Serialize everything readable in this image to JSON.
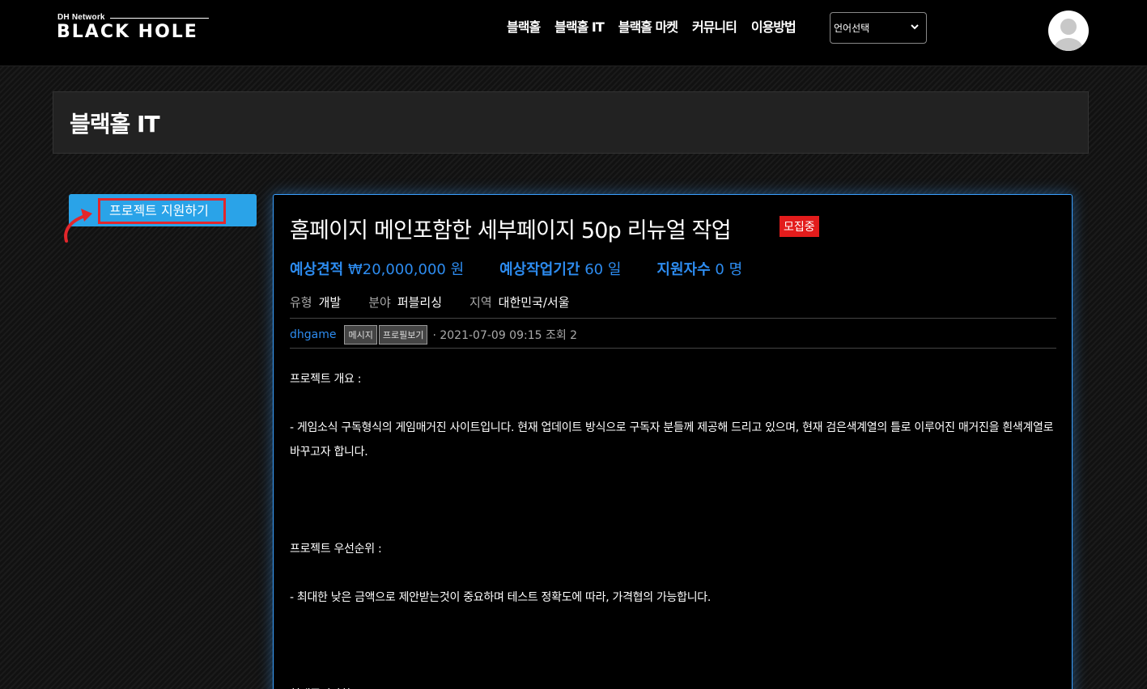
{
  "header": {
    "logo_small": "DH Network",
    "logo_main": "BLACK HOLE",
    "nav": [
      "블랙홀",
      "블랙홀 IT",
      "블랙홀 마켓",
      "커뮤니티",
      "이용방법"
    ],
    "lang_select": "언어선택"
  },
  "page": {
    "title": "블랙홀 IT"
  },
  "sidebar": {
    "apply_label": "프로젝트 지원하기"
  },
  "post": {
    "title": "홈페이지 메인포함한 세부페이지 50p 리뉴얼 작업",
    "status": "모집중",
    "stats": [
      {
        "label": "예상견적",
        "value": "₩20,000,000 원"
      },
      {
        "label": "예상작업기간",
        "value": "60 일"
      },
      {
        "label": "지원자수",
        "value": "0 명"
      }
    ],
    "meta": [
      {
        "key": "유형",
        "value": "개발"
      },
      {
        "key": "분야",
        "value": "퍼블리싱"
      },
      {
        "key": "지역",
        "value": "대한민국/서울"
      }
    ],
    "author": "dhgame",
    "message_btn": "메시지",
    "profile_btn": "프로필보기",
    "date_views": "· 2021-07-09 09:15 조회 2",
    "body": [
      "프로젝트 개요 :",
      "",
      "- 게임소식 구독형식의 게임매거진 사이트입니다. 현재 업데이트 방식으로 구독자 분들께 제공해 드리고 있으며, 현재 검은색계열의 틀로 이루어진 매거진을 흰색계열로 바꾸고자 합니다.",
      "",
      "",
      "",
      "프로젝트 우선순위 :",
      "",
      "- 최대한 낮은 금액으로 제안받는것이 중요하며 테스트 정확도에 따라, 가격협의 가능합니다.",
      "",
      "",
      "",
      "현재준비사항 :"
    ]
  },
  "colors": {
    "accent": "#2d8cf0",
    "apply_btn": "#2aa3e8",
    "badge": "#e31c1c",
    "highlight": "#e3262b"
  }
}
